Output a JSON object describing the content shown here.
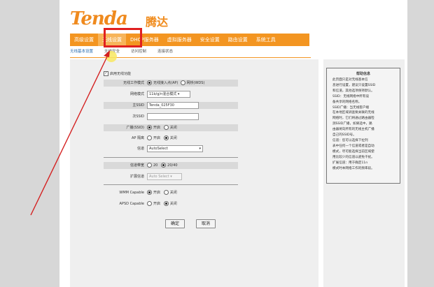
{
  "brand": {
    "logo_text": "Tenda",
    "logo_cn": "腾达"
  },
  "nav": [
    {
      "label": "高级设置",
      "active": false
    },
    {
      "label": "无线设置",
      "active": true
    },
    {
      "label": "DHCP服务器",
      "active": false
    },
    {
      "label": "虚拟服务器",
      "active": false
    },
    {
      "label": "安全设置",
      "active": false
    },
    {
      "label": "路由设置",
      "active": false
    },
    {
      "label": "系统工具",
      "active": false
    }
  ],
  "subnav": [
    {
      "label": "无线基本设置",
      "active": true
    },
    {
      "label": "无线安全",
      "active": false
    },
    {
      "label": "访问控制",
      "active": false
    },
    {
      "label": "连接状态",
      "active": false
    }
  ],
  "form": {
    "enable_wireless": "启用无线功能",
    "mode": {
      "label": "无线工作模式",
      "opt1": "无线接入点(AP)",
      "opt2": "网桥(WDS)"
    },
    "network_mode": {
      "label": "网络模式",
      "value": "11b/g/n混合模式"
    },
    "ssid": {
      "label": "主SSID",
      "value": "Tenda_025F30"
    },
    "ssid2": {
      "label": "次SSID",
      "value": ""
    },
    "broadcast": {
      "label": "广播(SSID)",
      "on": "开启",
      "off": "关闭"
    },
    "ap_isolation": {
      "label": "AP 隔离",
      "on": "开启",
      "off": "关闭"
    },
    "channel": {
      "label": "信道",
      "value": "AutoSelect"
    },
    "bandwidth": {
      "label": "信道带宽",
      "opt1": "20",
      "opt2": "20/40"
    },
    "ext_channel": {
      "label": "扩展信道",
      "value": "Auto Select"
    },
    "wmm": {
      "label": "WMM Capable",
      "on": "开启",
      "off": "关闭"
    },
    "apsd": {
      "label": "APSD Capable",
      "on": "开启",
      "off": "关闭"
    },
    "ok_button": "确定",
    "cancel_button": "取消"
  },
  "help": {
    "title": "帮助信息",
    "body": "此页面只是对无线基本信\n息进行设置，建议只设置SSID\n和信道，其他选项保持默认。\n  SSID：无线网络中所有设\n备共享的网络名称。\n  SSID广播：当无线客户端\n在本地区域调查要关联的无线\n网络时，它们将通过路由器检\n测SSID广播，如果选中，路\n由器将向所有的无线主机广播\n自己的SSID号。\n  信道：您可以选择下拉列\n表中任何一个信道或者是自动\n模式，尽可能选择当前区域使\n用比较少的信道以避免干扰。\n  扩展信道：用于确定11n\n模式时本网络工作的频率段。"
  }
}
